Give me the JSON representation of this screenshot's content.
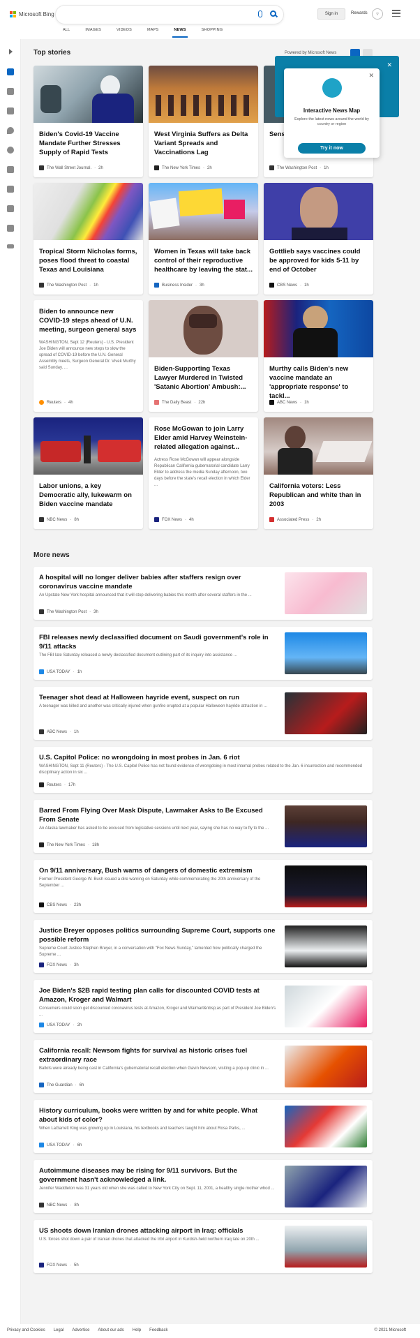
{
  "header": {
    "brand": "Microsoft Bing",
    "signin_label": "Sign in",
    "rewards_label": "Rewards",
    "tabs": [
      {
        "label": "ALL"
      },
      {
        "label": "IMAGES"
      },
      {
        "label": "VIDEOS"
      },
      {
        "label": "MAPS"
      },
      {
        "label": "NEWS"
      },
      {
        "label": "SHOPPING"
      }
    ],
    "active_tab": "NEWS"
  },
  "top_stories": {
    "title": "Top stories",
    "powered_by": "Powered by Microsoft News",
    "cards": [
      {
        "title": "Biden's Covid-19 Vaccine Mandate Further Stresses Supply of Rapid Tests",
        "body": "",
        "source": "The Wall Street Journal.",
        "age": "2h"
      },
      {
        "title": "West Virginia Suffers as Delta Variant Spreads and Vaccinations Lag",
        "body": "",
        "source": "The New York Times",
        "age": "2h"
      },
      {
        "title": "Sens... squa... over...",
        "body": "",
        "source": "The Washington Post",
        "age": "1h"
      },
      {
        "title": "Tropical Storm Nicholas forms, poses flood threat to coastal Texas and Louisiana",
        "body": "",
        "source": "The Washington Post",
        "age": "1h"
      },
      {
        "title": "Women in Texas will take back control of their reproductive healthcare by leaving the stat...",
        "body": "",
        "source": "Business Insider",
        "age": "3h"
      },
      {
        "title": "Gottlieb says vaccines could be approved for kids 5-11 by end of October",
        "body": "",
        "source": "CBS News",
        "age": "1h"
      },
      {
        "title": "Biden to announce new COVID-19 steps ahead of U.N. meeting, surgeon general says",
        "body": "WASHINGTON, Sept 12 (Reuters) - U.S. President Joe Biden will announce new steps to slow the spread of COVID-19 before the U.N. General Assembly meets, Surgeon General Dr. Vivek Murthy said Sunday. ...",
        "source": "Reuters",
        "age": "4h"
      },
      {
        "title": "Biden-Supporting Texas Lawyer Murdered in Twisted 'Satanic Abortion' Ambush:...",
        "body": "",
        "source": "The Daily Beast",
        "age": "22h"
      },
      {
        "title": "Murthy calls Biden's new vaccine mandate an 'appropriate response' to tackl...",
        "body": "",
        "source": "ABC News",
        "age": "1h"
      },
      {
        "title": "Labor unions, a key Democratic ally, lukewarm on Biden vaccine mandate",
        "body": "",
        "source": "NBC News",
        "age": "8h"
      },
      {
        "title": "Rose McGowan to join Larry Elder amid Harvey Weinstein-related allegation against...",
        "body": "Actress Rose McGowan will appear alongside Republican California gubernatorial candidate Larry Elder to address the media Sunday afternoon, two days before the state's recall election in which Elder ...",
        "source": "FOX News",
        "age": "4h"
      },
      {
        "title": "California voters: Less Republican and white than in 2003",
        "body": "",
        "source": "Associated Press",
        "age": "2h"
      }
    ]
  },
  "popup": {
    "title": "Interactive News Map",
    "description": "Explore the latest news around the world by country or region",
    "button": "Try it now"
  },
  "more_news": {
    "title": "More news",
    "items": [
      {
        "title": "A hospital will no longer deliver babies after staffers resign over coronavirus vaccine mandate",
        "summary": "An Upstate New York hospital announced that it will stop delivering babies this month after several staffers in the ...",
        "source": "The Washington Post",
        "age": "3h"
      },
      {
        "title": "FBI releases newly declassified document on Saudi government's role in 9/11 attacks",
        "summary": "The FBI late Saturday released a newly declassified document outlining part of its inquiry into assistance ...",
        "source": "USA TODAY",
        "age": "1h"
      },
      {
        "title": "Teenager shot dead at Halloween hayride event, suspect on run",
        "summary": "A teenager was killed and another was critically injured when gunfire erupted at a popular Halloween hayride attraction in ...",
        "source": "ABC News",
        "age": "1h"
      },
      {
        "title": "U.S. Capitol Police: no wrongdoing in most probes in Jan. 6 riot",
        "summary": "WASHINGTON, Sept 11 (Reuters) - The U.S. Capitol Police has not found evidence of wrongdoing in most internal probes related to the Jan. 6 insurrection and recommended disciplinary action in six ...",
        "source": "Reuters",
        "age": "17h"
      },
      {
        "title": "Barred From Flying Over Mask Dispute, Lawmaker Asks to Be Excused From Senate",
        "summary": "An Alaska lawmaker has asked to be excused from legislative sessions until next year, saying she has no way to fly to the ...",
        "source": "The New York Times",
        "age": "18h"
      },
      {
        "title": "On 9/11 anniversary, Bush warns of dangers of domestic extremism",
        "summary": "Former President George W. Bush issued a dire warning on Saturday while commemorating the 20th anniversary of the September ...",
        "source": "CBS News",
        "age": "23h"
      },
      {
        "title": "Justice Breyer opposes politics surrounding Supreme Court, supports one possible reform",
        "summary": "Supreme Court Justice Stephen Breyer, in a conversation with \"Fox News Sunday,\" lamented how politically charged the Supreme ...",
        "source": "FOX News",
        "age": "3h"
      },
      {
        "title": "Joe Biden's $2B rapid testing plan calls for discounted COVID tests at Amazon, Kroger and Walmart",
        "summary": "Consumers could soon get discounted coronavirus tests at Amazon, Kroger and Walmart&nbsp;as part of President Joe Biden's ...",
        "source": "USA TODAY",
        "age": "2h"
      },
      {
        "title": "California recall: Newsom fights for survival as historic crises fuel extraordinary race",
        "summary": "Ballots were already being cast in California's gubernatorial recall election when Gavin Newsom, visiting a pop-up clinic in ...",
        "source": "The Guardian",
        "age": "6h"
      },
      {
        "title": "History curriculum, books were written by and for white people. What about kids of color?",
        "summary": "When LaGarrett King was growing up in Louisiana, his textbooks and teachers taught him about Rosa Parks, ...",
        "source": "USA TODAY",
        "age": "6h"
      },
      {
        "title": "Autoimmune diseases may be rising for 9/11 survivors. But the government hasn't acknowledged a link.",
        "summary": "Jennifer Waddleton was 31 years old when she was called to New York City on Sept. 11, 2001, a healthy single mother whod ...",
        "source": "NBC News",
        "age": "8h"
      },
      {
        "title": "US shoots down Iranian drones attacking airport in Iraq: officials",
        "summary": "U.S. forces shot down a pair of Iranian drones that attacked the Irbil airport in Kurdish-held northern Iraq late on 20th ...",
        "source": "FOX News",
        "age": "5h"
      }
    ]
  },
  "footer": {
    "links": [
      "Privacy and Cookies",
      "Legal",
      "Advertise",
      "About our ads",
      "Help",
      "Feedback"
    ],
    "copyright": "© 2021 Microsoft"
  },
  "colors": {
    "accent": "#0a66c2",
    "map_teal": "#0a7fa8"
  }
}
